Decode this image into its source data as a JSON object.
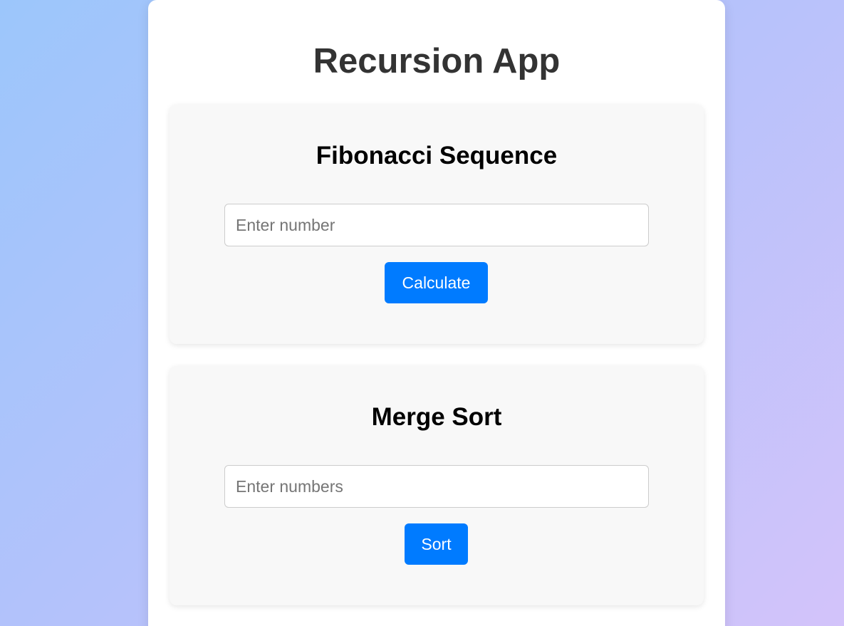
{
  "app": {
    "title": "Recursion App"
  },
  "fibonacci": {
    "title": "Fibonacci Sequence",
    "input_placeholder": "Enter number",
    "input_value": "",
    "button_label": "Calculate"
  },
  "merge_sort": {
    "title": "Merge Sort",
    "input_placeholder": "Enter numbers",
    "input_value": "",
    "button_label": "Sort"
  },
  "colors": {
    "accent": "#007bff",
    "background_start": "#9cc6fb",
    "background_end": "#d3c3fa"
  }
}
